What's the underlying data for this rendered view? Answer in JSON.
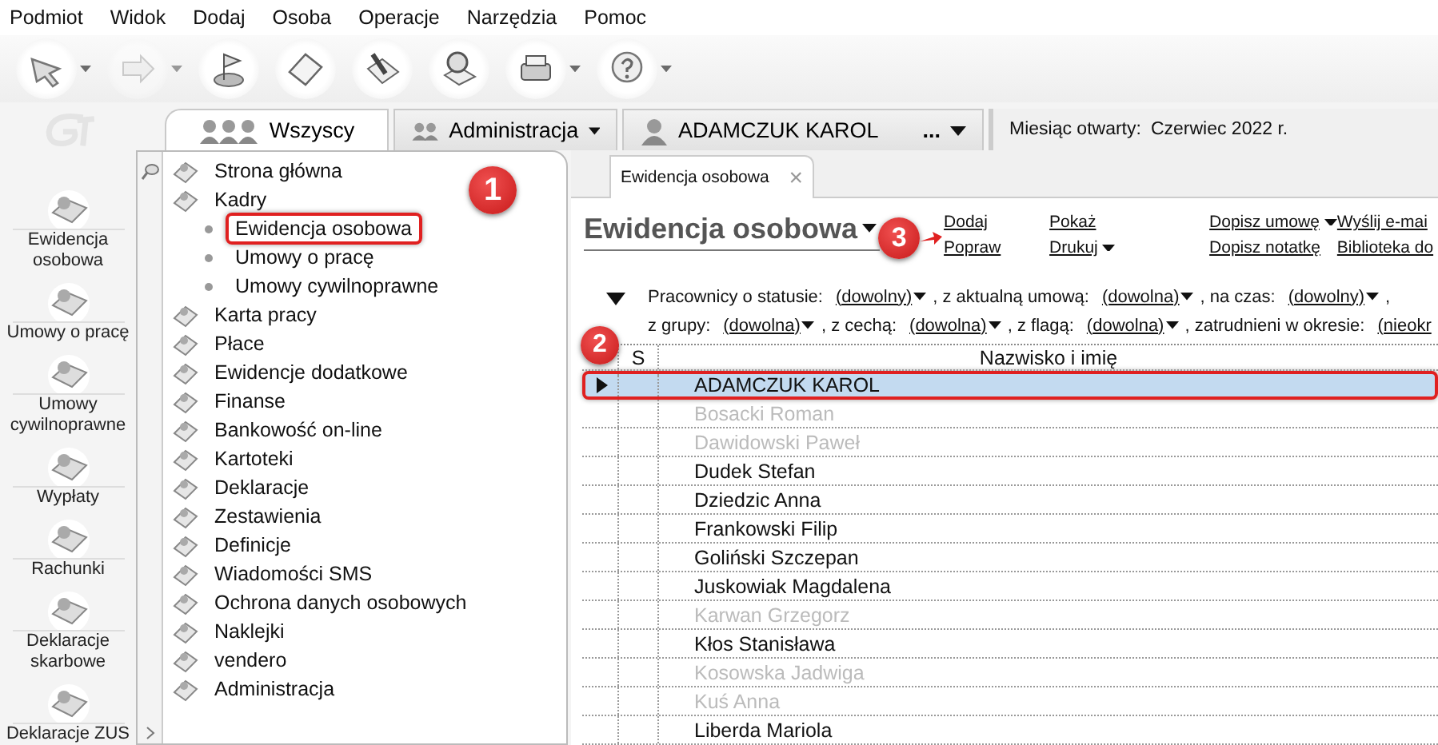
{
  "menu": [
    "Podmiot",
    "Widok",
    "Dodaj",
    "Osoba",
    "Operacje",
    "Narzędzia",
    "Pomoc"
  ],
  "toolbar": [
    {
      "dropdown": true,
      "disabled": false
    },
    {
      "dropdown": true,
      "disabled": true
    },
    {
      "dropdown": false,
      "disabled": false
    },
    {
      "dropdown": false,
      "disabled": false
    },
    {
      "dropdown": false,
      "disabled": false
    },
    {
      "dropdown": false,
      "disabled": false
    },
    {
      "dropdown": true,
      "disabled": false
    },
    {
      "dropdown": true,
      "disabled": false
    }
  ],
  "nav": [
    "Ewidencja osobowa",
    "Umowy o pracę",
    "Umowy cywilnoprawne",
    "Wypłaty",
    "Rachunki",
    "Deklaracje skarbowe",
    "Deklaracje ZUS"
  ],
  "tabs": [
    {
      "kind": "group",
      "label": "Wszyscy",
      "selected": true,
      "dropdown": false
    },
    {
      "kind": "group",
      "label": "Administracja",
      "selected": false,
      "dropdown": true
    },
    {
      "kind": "person",
      "label": "ADAMCZUK KAROL",
      "more": "...",
      "selected": false,
      "dropdown": true
    }
  ],
  "month": {
    "label": "Miesiąc otwarty:",
    "value": "Czerwiec 2022 r."
  },
  "tree": [
    {
      "label": "Strona główna"
    },
    {
      "label": "Kadry",
      "children": [
        {
          "label": "Ewidencja osobowa",
          "highlighted": true,
          "marker": "1"
        },
        {
          "label": "Umowy o pracę"
        },
        {
          "label": "Umowy cywilnoprawne"
        }
      ]
    },
    {
      "label": "Karta pracy"
    },
    {
      "label": "Płace"
    },
    {
      "label": "Ewidencje dodatkowe"
    },
    {
      "label": "Finanse"
    },
    {
      "label": "Bankowość on-line"
    },
    {
      "label": "Kartoteki"
    },
    {
      "label": "Deklaracje"
    },
    {
      "label": "Zestawienia"
    },
    {
      "label": "Definicje"
    },
    {
      "label": "Wiadomości SMS"
    },
    {
      "label": "Ochrona danych osobowych"
    },
    {
      "label": "Naklejki"
    },
    {
      "label": "vendero"
    },
    {
      "label": "Administracja"
    }
  ],
  "doc_tab": {
    "label": "Ewidencja osobowa",
    "close": "×"
  },
  "title": "Ewidencja osobowa",
  "actions": [
    [
      {
        "label": "Dodaj"
      },
      {
        "label": "Popraw",
        "marker": "3"
      }
    ],
    [
      {
        "label": "Pokaż"
      },
      {
        "label": "Drukuj",
        "dropdown": true
      }
    ],
    [
      {
        "label": "Dopisz umowę",
        "dropdown": true
      },
      {
        "label": "Dopisz notatkę"
      }
    ],
    [
      {
        "label": "Wyślij e-mai"
      },
      {
        "label": "Biblioteka do"
      }
    ]
  ],
  "filters": [
    [
      {
        "kind": "text",
        "text": "Pracownicy o statusie:"
      },
      {
        "kind": "choice",
        "text": "(dowolny)"
      },
      {
        "kind": "text",
        "text": ", z aktualną umową:"
      },
      {
        "kind": "choice",
        "text": "(dowolna)"
      },
      {
        "kind": "text",
        "text": ", na czas:"
      },
      {
        "kind": "choice",
        "text": "(dowolny)"
      },
      {
        "kind": "text",
        "text": ","
      }
    ],
    [
      {
        "kind": "text",
        "text": "z grupy:"
      },
      {
        "kind": "choice",
        "text": "(dowolna)"
      },
      {
        "kind": "text",
        "text": ", z cechą:"
      },
      {
        "kind": "choice",
        "text": "(dowolna)"
      },
      {
        "kind": "text",
        "text": ", z flagą:"
      },
      {
        "kind": "choice",
        "text": "(dowolna)"
      },
      {
        "kind": "text",
        "text": ", zatrudnieni w okresie:"
      },
      {
        "kind": "cut",
        "text": "(nieokr"
      }
    ]
  ],
  "table": {
    "columns": [
      "S",
      "Nazwisko i imię"
    ],
    "rows": [
      {
        "name": "ADAMCZUK KAROL",
        "selected": true,
        "inactive": false,
        "highlighted": true,
        "marker": "2"
      },
      {
        "name": "Bosacki Roman",
        "selected": false,
        "inactive": true
      },
      {
        "name": "Dawidowski Paweł",
        "selected": false,
        "inactive": true
      },
      {
        "name": "Dudek Stefan",
        "selected": false,
        "inactive": false
      },
      {
        "name": "Dziedzic Anna",
        "selected": false,
        "inactive": false
      },
      {
        "name": "Frankowski Filip",
        "selected": false,
        "inactive": false
      },
      {
        "name": "Goliński Szczepan",
        "selected": false,
        "inactive": false
      },
      {
        "name": "Juskowiak Magdalena",
        "selected": false,
        "inactive": false
      },
      {
        "name": "Karwan Grzegorz",
        "selected": false,
        "inactive": true
      },
      {
        "name": "Kłos Stanisława",
        "selected": false,
        "inactive": false
      },
      {
        "name": "Kosowska Jadwiga",
        "selected": false,
        "inactive": true
      },
      {
        "name": "Kuś Anna",
        "selected": false,
        "inactive": true
      },
      {
        "name": "Liberda Mariola",
        "selected": false,
        "inactive": false
      }
    ]
  }
}
